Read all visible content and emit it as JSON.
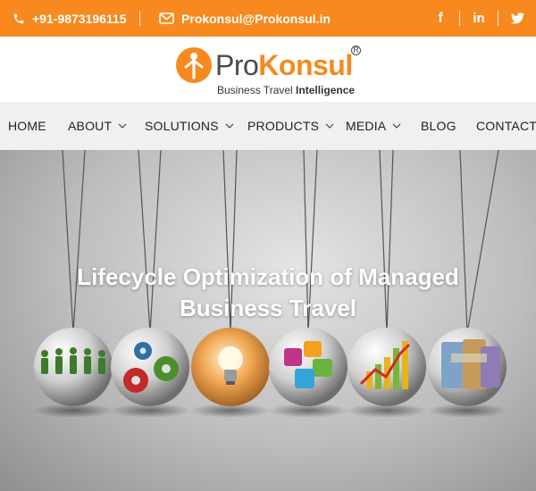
{
  "topbar": {
    "phone": "+91-9873196115",
    "email": "Prokonsul@Prokonsul.in",
    "social": [
      "facebook-icon",
      "linkedin-icon",
      "twitter-icon"
    ],
    "social_labels": {
      "facebook": "f",
      "linkedin": "in"
    },
    "bg_color": "#f7891f"
  },
  "logo": {
    "word_pro": "Pro",
    "word_konsul": "Konsul",
    "registered": "R",
    "tagline_light": "Business Travel ",
    "tagline_bold": "Intelligence"
  },
  "nav": {
    "items": [
      {
        "label": "HOME",
        "has_dropdown": false
      },
      {
        "label": "ABOUT",
        "has_dropdown": true
      },
      {
        "label": "SOLUTIONS",
        "has_dropdown": true
      },
      {
        "label": "PRODUCTS",
        "has_dropdown": true
      },
      {
        "label": "MEDIA",
        "has_dropdown": true
      },
      {
        "label": "BLOG",
        "has_dropdown": false
      },
      {
        "label": "CONTACT",
        "has_dropdown": false
      }
    ]
  },
  "hero": {
    "title_line1": "Lifecycle Optimization of Managed",
    "title_line2": "Business Travel",
    "balls": [
      "people-ball",
      "gears-ball",
      "lightbulb-ball",
      "puzzle-ball",
      "chart-ball",
      "currency-ball"
    ]
  }
}
